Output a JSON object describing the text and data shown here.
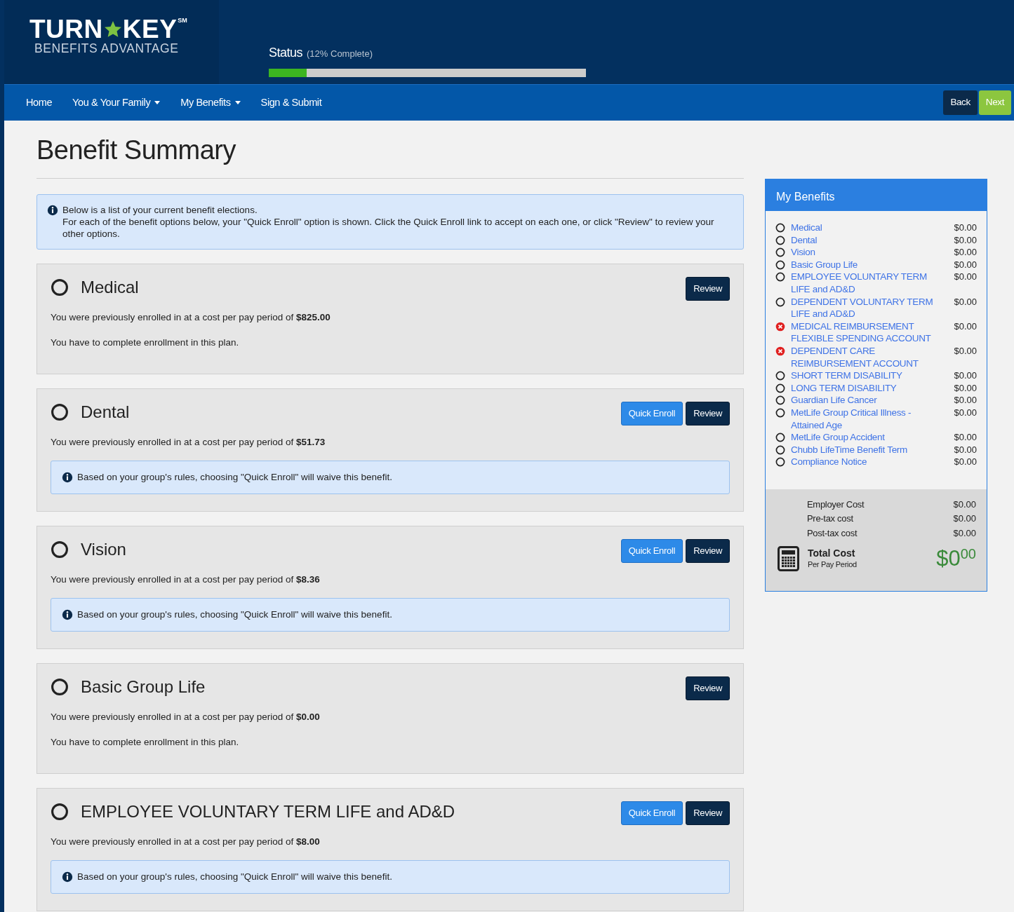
{
  "header": {
    "logo": {
      "word_1": "TURN",
      "word_2": "KEY",
      "mark": "SM",
      "tagline": "BENEFITS ADVANTAGE"
    },
    "status": {
      "label": "Status",
      "detail": "(12% Complete)",
      "level": 0.12
    }
  },
  "nav": {
    "items": [
      {
        "label": "Home",
        "dropdown": false
      },
      {
        "label": "You & Your Family",
        "dropdown": true
      },
      {
        "label": "My Benefits",
        "dropdown": true
      },
      {
        "label": "Sign & Submit",
        "dropdown": false
      }
    ],
    "buttons": [
      {
        "kind": "back",
        "label": "Back"
      },
      {
        "kind": "next",
        "label": "Next"
      }
    ]
  },
  "title": "Benefit Summary",
  "intro": {
    "lines": [
      "Below is a list of your current benefit elections.",
      "For each of the benefit options below, your \"Quick Enroll\" option is shown. Click the Quick Enroll link to accept on each one, or click \"Review\" to review your other options."
    ]
  },
  "cards": [
    {
      "name": "Medical",
      "buttons": [
        {
          "kind": "review",
          "label": "Review"
        }
      ],
      "cost_text": "You were previously enrolled in at a cost per pay period of **$825.00**",
      "note": {
        "kind": "text",
        "text": "You have to complete enrollment in this plan."
      }
    },
    {
      "name": "Dental",
      "buttons": [
        {
          "kind": "quick",
          "label": "Quick Enroll"
        },
        {
          "kind": "review",
          "label": "Review"
        }
      ],
      "cost_text": "You were previously enrolled in at a cost per pay period of **$51.73**",
      "note": {
        "kind": "alert",
        "text": "Based on your group's rules, choosing \"Quick Enroll\" will waive this benefit."
      }
    },
    {
      "name": "Vision",
      "buttons": [
        {
          "kind": "quick",
          "label": "Quick Enroll"
        },
        {
          "kind": "review",
          "label": "Review"
        }
      ],
      "cost_text": "You were previously enrolled in at a cost per pay period of **$8.36**",
      "note": {
        "kind": "alert",
        "text": "Based on your group's rules, choosing \"Quick Enroll\" will waive this benefit."
      }
    },
    {
      "name": "Basic Group Life",
      "buttons": [
        {
          "kind": "review",
          "label": "Review"
        }
      ],
      "cost_text": "You were previously enrolled in at a cost per pay period of **$0.00**",
      "note": {
        "kind": "text",
        "text": "You have to complete enrollment in this plan."
      }
    },
    {
      "name": "EMPLOYEE VOLUNTARY TERM LIFE and AD&D",
      "buttons": [
        {
          "kind": "quick",
          "label": "Quick Enroll"
        },
        {
          "kind": "review",
          "label": "Review"
        }
      ],
      "cost_text": "You were previously enrolled in at a cost per pay period of **$8.00**",
      "note": {
        "kind": "alert",
        "text": "Based on your group's rules, choosing \"Quick Enroll\" will waive this benefit."
      }
    }
  ],
  "sidebar": {
    "title": "My Benefits",
    "items": [
      {
        "label": "Medical",
        "amount": "$0.00",
        "kind": "open"
      },
      {
        "label": "Dental",
        "amount": "$0.00",
        "kind": "open"
      },
      {
        "label": "Vision",
        "amount": "$0.00",
        "kind": "open"
      },
      {
        "label": "Basic Group Life",
        "amount": "$0.00",
        "kind": "open"
      },
      {
        "label": "EMPLOYEE VOLUNTARY TERM LIFE and AD&D",
        "amount": "$0.00",
        "kind": "open"
      },
      {
        "label": "DEPENDENT VOLUNTARY TERM LIFE and AD&D",
        "amount": "$0.00",
        "kind": "open"
      },
      {
        "label": "MEDICAL REIMBURSEMENT FLEXIBLE SPENDING ACCOUNT",
        "amount": "$0.00",
        "kind": "error"
      },
      {
        "label": "DEPENDENT CARE REIMBURSEMENT ACCOUNT",
        "amount": "$0.00",
        "kind": "error"
      },
      {
        "label": "SHORT TERM DISABILITY",
        "amount": "$0.00",
        "kind": "open"
      },
      {
        "label": "LONG TERM DISABILITY",
        "amount": "$0.00",
        "kind": "open"
      },
      {
        "label": "Guardian Life Cancer",
        "amount": "$0.00",
        "kind": "open"
      },
      {
        "label": "MetLife Group Critical Illness - Attained Age",
        "amount": "$0.00",
        "kind": "open"
      },
      {
        "label": "MetLife Group Accident",
        "amount": "$0.00",
        "kind": "open"
      },
      {
        "label": "Chubb LifeTime Benefit Term",
        "amount": "$0.00",
        "kind": "open"
      },
      {
        "label": "Compliance Notice",
        "amount": "$0.00",
        "kind": "open"
      }
    ],
    "costs": [
      {
        "label": "Employer Cost",
        "amount": "$0.00"
      },
      {
        "label": "Pre-tax cost",
        "amount": "$0.00"
      },
      {
        "label": "Post-tax cost",
        "amount": "$0.00"
      }
    ],
    "total": {
      "label": "Total Cost",
      "sublabel": "Per Pay Period",
      "amount": "$0",
      "cents": "00"
    }
  }
}
